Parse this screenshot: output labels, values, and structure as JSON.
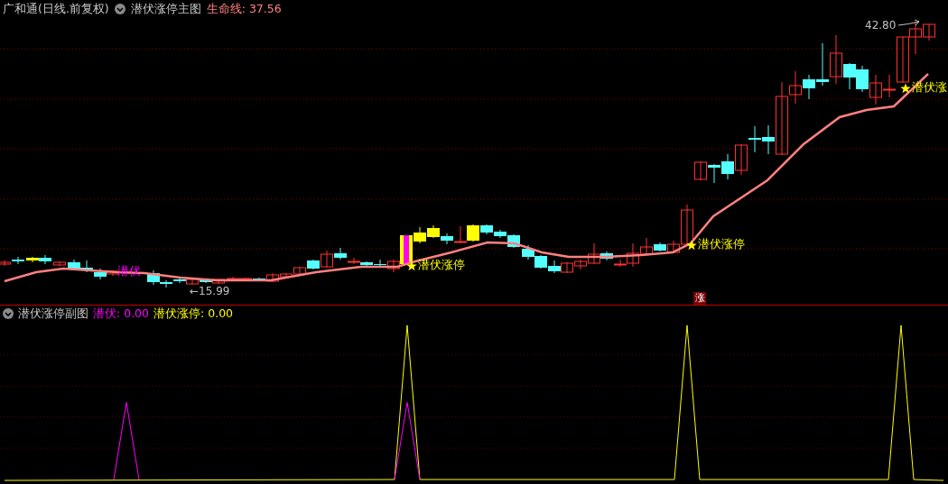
{
  "main_chart": {
    "stock": "广和通(日线.前复权)",
    "indicator": "潜伏涨停主图",
    "lines": [
      {
        "label": "生命线:",
        "value": "37.56",
        "color": "#ff8080"
      }
    ],
    "markers": [
      {
        "kind": "latent",
        "label": "潜伏"
      },
      {
        "kind": "limit",
        "label": "潜伏涨停"
      },
      {
        "kind": "limit",
        "label": "潜伏涨停"
      },
      {
        "kind": "limit",
        "label": "潜伏涨"
      }
    ],
    "price_labels": [
      {
        "kind": "low",
        "text": "←15.99"
      },
      {
        "kind": "high",
        "text": "42.80"
      }
    ],
    "badge": "涨"
  },
  "sub_chart": {
    "indicator": "潜伏涨停副图",
    "values": [
      {
        "label": "潜伏:",
        "value": "0.00",
        "color": "#ff00ff"
      },
      {
        "label": "潜伏涨停:",
        "value": "0.00",
        "color": "#ffff00"
      }
    ]
  }
}
